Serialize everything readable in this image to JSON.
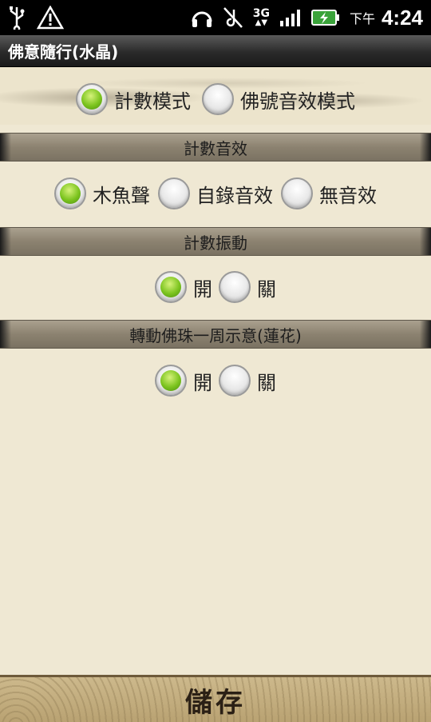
{
  "statusbar": {
    "icons": [
      "usb-icon",
      "warning-icon",
      "headphones-icon",
      "no-sound-icon",
      "3g-icon",
      "signal-icon",
      "battery-icon"
    ],
    "network": "3G",
    "ampm": "下午",
    "time": "4:24"
  },
  "titlebar": {
    "title": "佛意隨行(水晶)"
  },
  "mode": {
    "options": [
      {
        "label": "計數模式",
        "selected": true
      },
      {
        "label": "佛號音效模式",
        "selected": false
      }
    ]
  },
  "sound": {
    "header": "計數音效",
    "options": [
      {
        "label": "木魚聲",
        "selected": true
      },
      {
        "label": "自錄音效",
        "selected": false
      },
      {
        "label": "無音效",
        "selected": false
      }
    ]
  },
  "vibration": {
    "header": "計數振動",
    "options": [
      {
        "label": "開",
        "selected": true
      },
      {
        "label": "關",
        "selected": false
      }
    ]
  },
  "rotation": {
    "header": "轉動佛珠一周示意(蓮花)",
    "options": [
      {
        "label": "開",
        "selected": true
      },
      {
        "label": "關",
        "selected": false
      }
    ]
  },
  "footer": {
    "save_label": "儲存"
  },
  "colors": {
    "accent_green": "#7cc41f",
    "background": "#efe8d3",
    "section_bar": "#8c8270"
  }
}
